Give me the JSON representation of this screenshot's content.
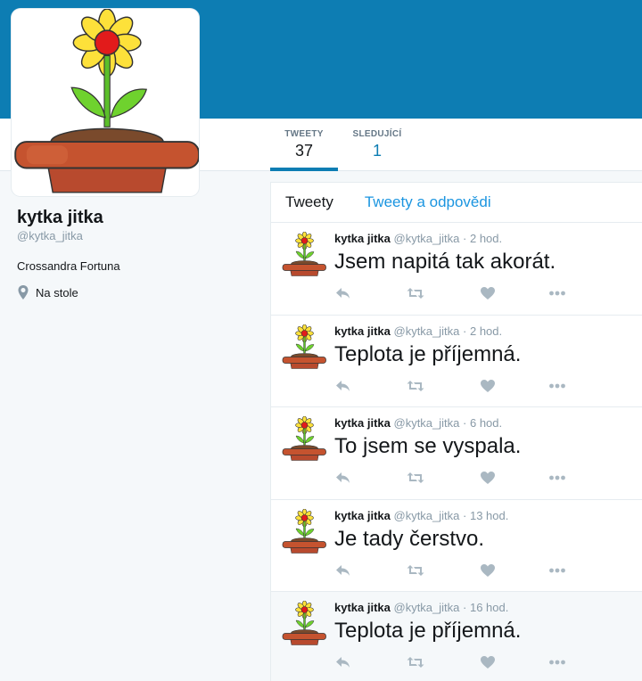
{
  "colors": {
    "banner": "#0d7db3",
    "accent": "#0d7db3",
    "link": "#1b95e0",
    "muted": "#8899a6",
    "text": "#14171a",
    "icon": "#aab8c2"
  },
  "profile": {
    "avatar_icon": "flower-pot-icon",
    "name": "kytka jitka",
    "handle": "@kytka_jitka",
    "bio": "Crossandra Fortuna",
    "location": "Na stole"
  },
  "nav": {
    "tweets_label": "TWEETY",
    "tweets_count": "37",
    "following_label": "SLEDUJÍCÍ",
    "following_count": "1"
  },
  "timeline": {
    "tabs": [
      {
        "label": "Tweety"
      },
      {
        "label": "Tweety a odpovědi"
      }
    ],
    "tweets": [
      {
        "name": "kytka jitka",
        "handle": "@kytka_jitka",
        "dot": "·",
        "time": "2 hod.",
        "text": "Jsem napitá tak akorát."
      },
      {
        "name": "kytka jitka",
        "handle": "@kytka_jitka",
        "dot": "·",
        "time": "2 hod.",
        "text": "Teplota je příjemná."
      },
      {
        "name": "kytka jitka",
        "handle": "@kytka_jitka",
        "dot": "·",
        "time": "6 hod.",
        "text": "To jsem se vyspala."
      },
      {
        "name": "kytka jitka",
        "handle": "@kytka_jitka",
        "dot": "·",
        "time": "13 hod.",
        "text": "Je tady čerstvo."
      },
      {
        "name": "kytka jitka",
        "handle": "@kytka_jitka",
        "dot": "·",
        "time": "16 hod.",
        "text": "Teplota je příjemná."
      }
    ]
  }
}
